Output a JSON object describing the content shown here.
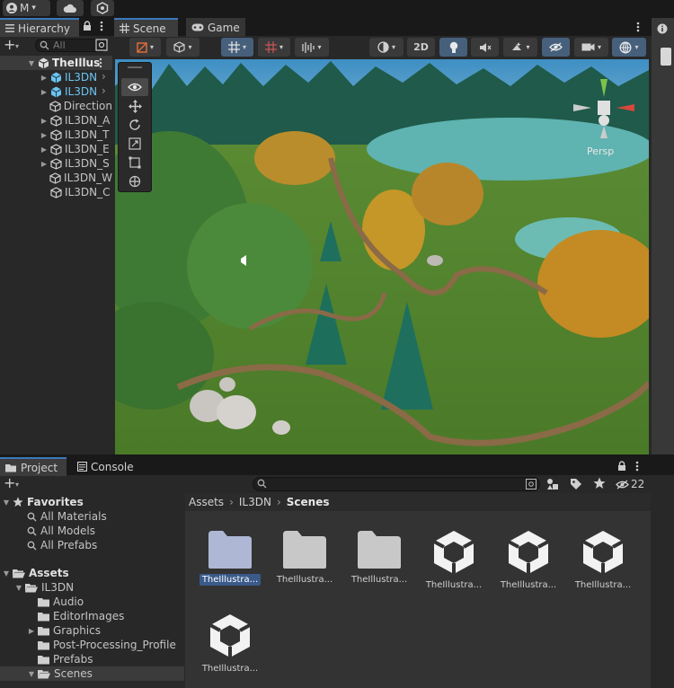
{
  "topbar": {
    "account_label": "M",
    "account_caret": "▾"
  },
  "hierarchy": {
    "tab_label": "Hierarchy",
    "add_label": "+",
    "search_placeholder": "All",
    "scene_name": "TheIllus",
    "items": [
      {
        "label": "IL3DN",
        "prefab": true,
        "foldout": true,
        "selected": true
      },
      {
        "label": "IL3DN",
        "prefab": true,
        "foldout": true,
        "selected": true
      },
      {
        "label": "Direction",
        "prefab": false,
        "foldout": false,
        "selected": false
      },
      {
        "label": "IL3DN_A",
        "prefab": false,
        "foldout": true,
        "selected": false
      },
      {
        "label": "IL3DN_T",
        "prefab": false,
        "foldout": true,
        "selected": false
      },
      {
        "label": "IL3DN_E",
        "prefab": false,
        "foldout": true,
        "selected": false
      },
      {
        "label": "IL3DN_S",
        "prefab": false,
        "foldout": true,
        "selected": false
      },
      {
        "label": "IL3DN_W",
        "prefab": false,
        "foldout": false,
        "selected": false
      },
      {
        "label": "IL3DN_C",
        "prefab": false,
        "foldout": false,
        "selected": false
      }
    ]
  },
  "scene": {
    "tab_scene": "Scene",
    "tab_game": "Game",
    "toggle_2d": "2D",
    "persp_label": "Persp"
  },
  "project": {
    "tab_project": "Project",
    "tab_console": "Console",
    "add_label": "+",
    "hidden_count": "22",
    "favorites": {
      "title": "Favorites",
      "items": [
        "All Materials",
        "All Models",
        "All Prefabs"
      ]
    },
    "assets": {
      "title": "Assets",
      "root": "IL3DN",
      "children": [
        {
          "label": "Audio",
          "foldout": false
        },
        {
          "label": "EditorImages",
          "foldout": false
        },
        {
          "label": "Graphics",
          "foldout": true
        },
        {
          "label": "Post-Processing_Profile",
          "foldout": false
        },
        {
          "label": "Prefabs",
          "foldout": false
        },
        {
          "label": "Scenes",
          "foldout": true,
          "selected": true
        }
      ]
    },
    "breadcrumb": [
      "Assets",
      "IL3DN",
      "Scenes"
    ],
    "grid_items": [
      {
        "label": "TheIllustra...",
        "kind": "folder",
        "selected": true
      },
      {
        "label": "TheIllustra...",
        "kind": "folder",
        "selected": false
      },
      {
        "label": "TheIllustra...",
        "kind": "folder",
        "selected": false
      },
      {
        "label": "TheIllustra...",
        "kind": "scene",
        "selected": false
      },
      {
        "label": "TheIllustra...",
        "kind": "scene",
        "selected": false
      },
      {
        "label": "TheIllustra...",
        "kind": "scene",
        "selected": false
      },
      {
        "label": "TheIllustra...",
        "kind": "scene",
        "selected": false
      }
    ]
  },
  "colors": {
    "accent": "#3a79bb",
    "selection": "#3a5a8a",
    "panel": "#282828",
    "prefab_blue": "#6cc4ef"
  }
}
